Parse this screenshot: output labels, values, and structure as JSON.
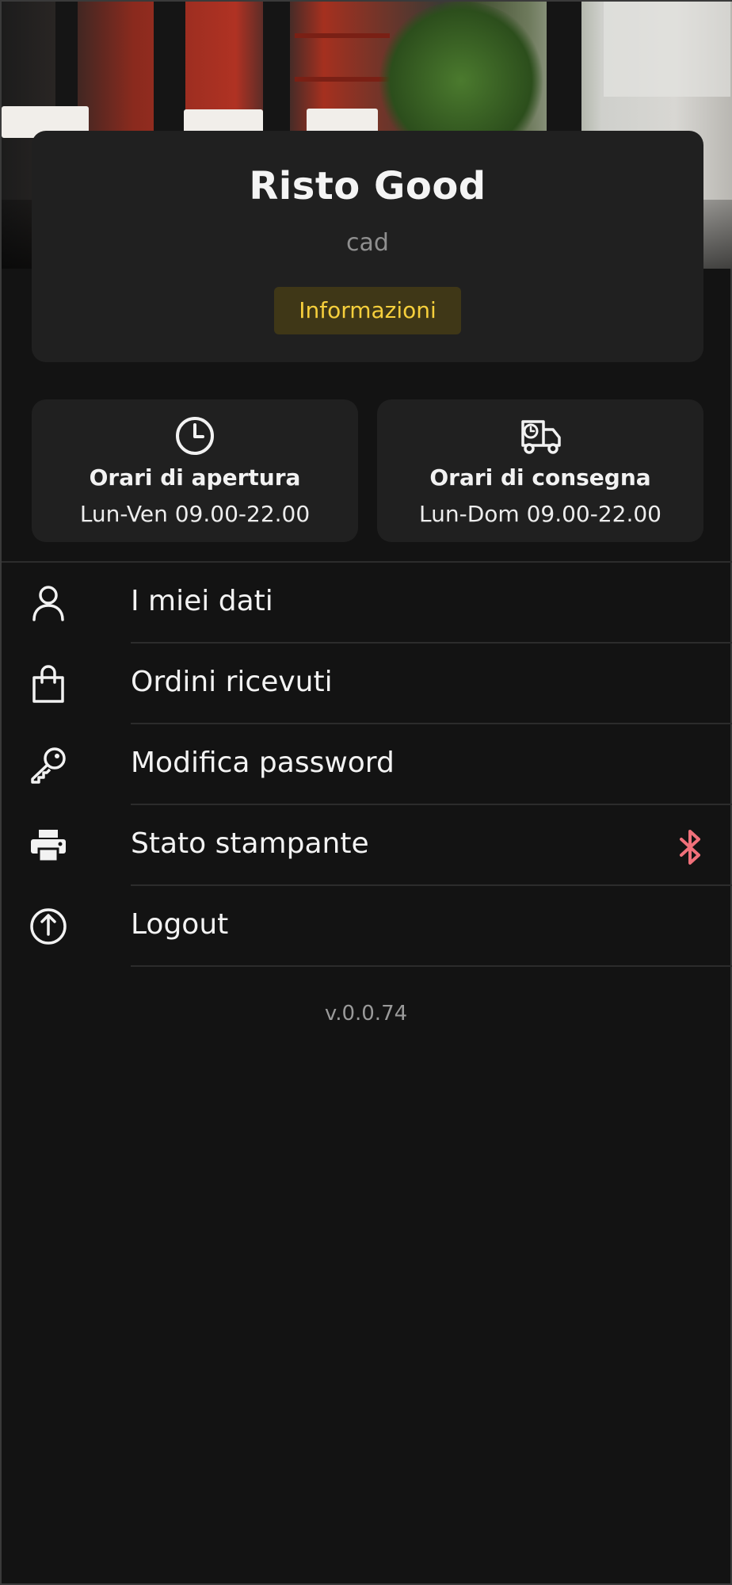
{
  "restaurant": {
    "name": "Risto Good",
    "subtitle": "cad",
    "info_button": "Informazioni"
  },
  "hours": [
    {
      "icon": "clock-icon",
      "label": "Orari di apertura",
      "value": "Lun-Ven 09.00-22.00"
    },
    {
      "icon": "delivery-truck-clock-icon",
      "label": "Orari di consegna",
      "value": "Lun-Dom 09.00-22.00"
    }
  ],
  "menu": {
    "items": [
      {
        "icon": "user-icon",
        "label": "I miei dati"
      },
      {
        "icon": "shopping-bag-icon",
        "label": "Ordini ricevuti"
      },
      {
        "icon": "key-icon",
        "label": "Modifica password"
      },
      {
        "icon": "printer-icon",
        "label": "Stato stampante",
        "status_icon": "bluetooth-icon"
      },
      {
        "icon": "power-icon",
        "label": "Logout"
      }
    ]
  },
  "version": "v.0.0.74",
  "colors": {
    "background": "#131313",
    "card": "#202020",
    "accent_yellow": "#f6cf3c",
    "accent_button_bg": "#3f3717",
    "bluetooth_status": "#f0707a"
  }
}
